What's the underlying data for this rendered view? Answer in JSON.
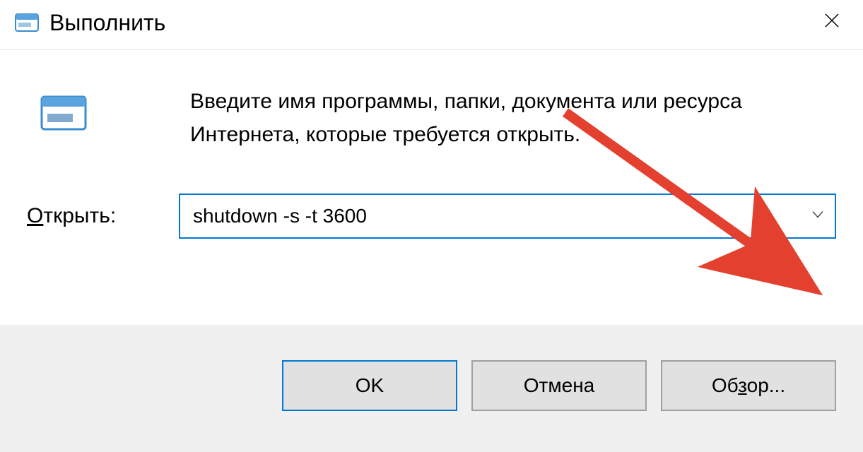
{
  "titlebar": {
    "title": "Выполнить"
  },
  "body": {
    "description": "Введите имя программы, папки, документа или ресурса Интернета, которые требуется открыть.",
    "open_label_pre": "О",
    "open_label_post": "ткрыть:",
    "field_value": "shutdown -s -t 3600"
  },
  "buttons": {
    "ok": "OK",
    "cancel": "Отмена",
    "browse_pre": "Об",
    "browse_u": "з",
    "browse_post": "ор..."
  }
}
